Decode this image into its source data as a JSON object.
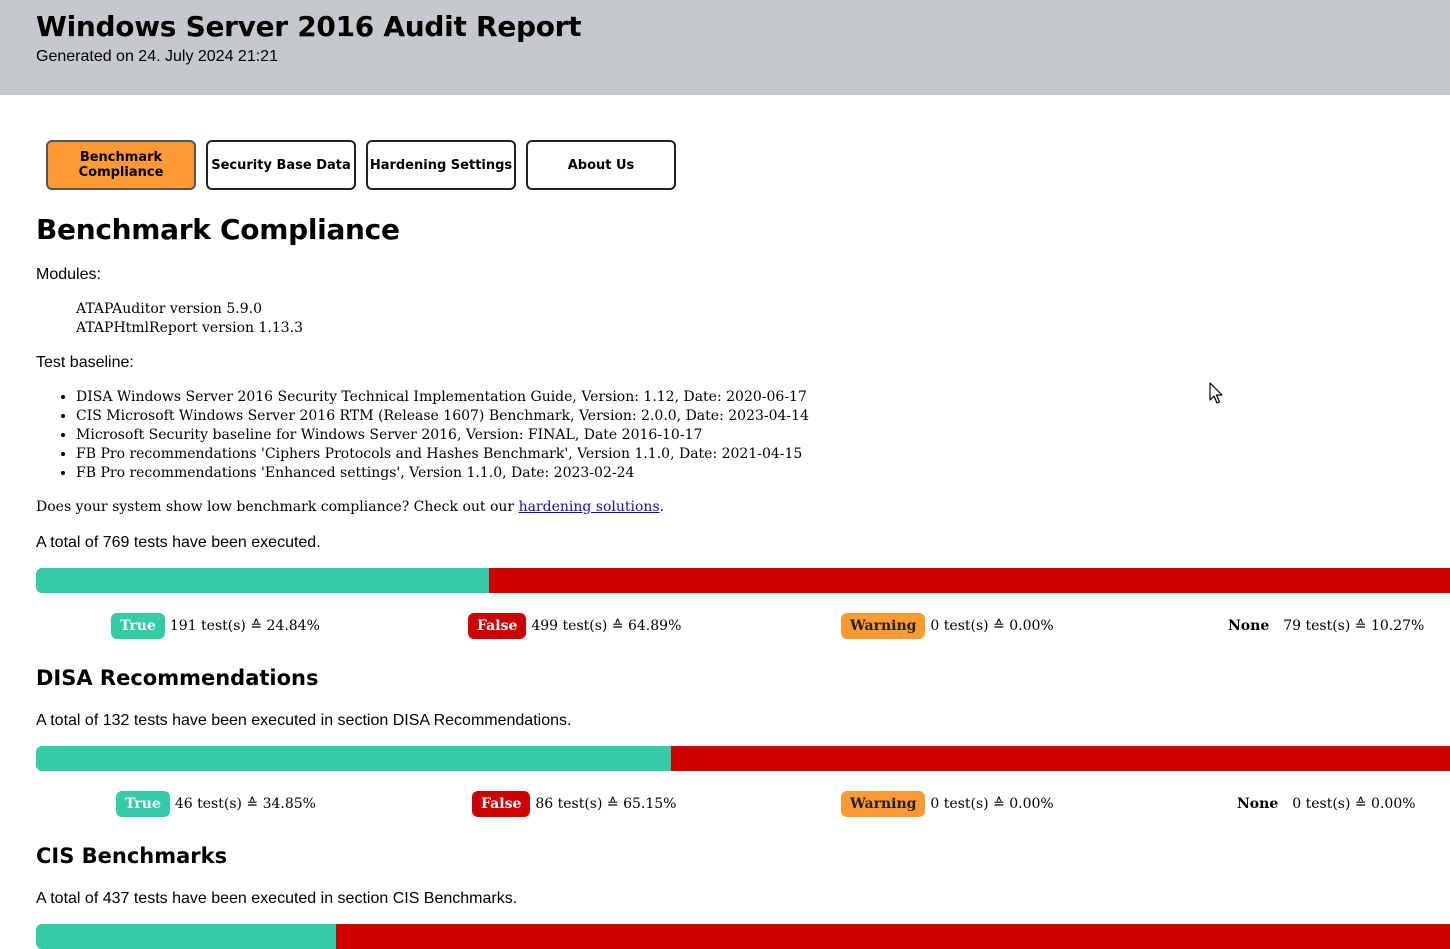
{
  "header": {
    "title": "Windows Server 2016 Audit Report",
    "generated": "Generated on 24. July 2024 21:21"
  },
  "tabs": [
    {
      "label": "Benchmark Compliance",
      "active": true
    },
    {
      "label": "Security Base Data",
      "active": false
    },
    {
      "label": "Hardening Settings",
      "active": false
    },
    {
      "label": "About Us",
      "active": false
    }
  ],
  "main": {
    "title": "Benchmark Compliance",
    "modules_label": "Modules:",
    "modules": [
      "ATAPAuditor version 5.9.0",
      "ATAPHtmlReport version 1.13.3"
    ],
    "baseline_label": "Test baseline:",
    "baseline": [
      "DISA Windows Server 2016 Security Technical Implementation Guide, Version: 1.12, Date: 2020-06-17",
      "CIS Microsoft Windows Server 2016 RTM (Release 1607) Benchmark, Version: 2.0.0, Date: 2023-04-14",
      "Microsoft Security baseline for Windows Server 2016, Version: FINAL, Date 2016-10-17",
      "FB Pro recommendations 'Ciphers Protocols and Hashes Benchmark', Version 1.1.0, Date: 2021-04-15",
      "FB Pro recommendations 'Enhanced settings', Version 1.1.0, Date: 2023-02-24"
    ],
    "hardening_prefix": "Does your system show low benchmark compliance? Check out our ",
    "hardening_link": "hardening solutions",
    "hardening_suffix": "."
  },
  "sections": [
    {
      "title": "",
      "total_text": "A total of 769 tests have been executed.",
      "true_fraction": 0.3203,
      "stats": [
        {
          "label": "True",
          "text": "191 test(s) ≙ 24.84%"
        },
        {
          "label": "False",
          "text": "499 test(s) ≙ 64.89%"
        },
        {
          "label": "Warning",
          "text": "0 test(s) ≙ 0.00%"
        },
        {
          "label": "None",
          "text": "79 test(s) ≙ 10.27%"
        }
      ]
    },
    {
      "title": "DISA Recommendations",
      "total_text": "A total of 132 tests have been executed in section DISA Recommendations.",
      "true_fraction": 0.4491,
      "stats": [
        {
          "label": "True",
          "text": "46 test(s) ≙ 34.85%"
        },
        {
          "label": "False",
          "text": "86 test(s) ≙ 65.15%"
        },
        {
          "label": "Warning",
          "text": "0 test(s) ≙ 0.00%"
        },
        {
          "label": "None",
          "text": "0 test(s) ≙ 0.00%"
        }
      ]
    },
    {
      "title": "CIS Benchmarks",
      "total_text": "A total of 437 tests have been executed in section CIS Benchmarks.",
      "true_fraction": 0.2122
    }
  ],
  "colors": {
    "true": "#33cca6",
    "false": "#cc0000",
    "warning": "#ff9933",
    "header_bg": "#c6c9cc"
  }
}
